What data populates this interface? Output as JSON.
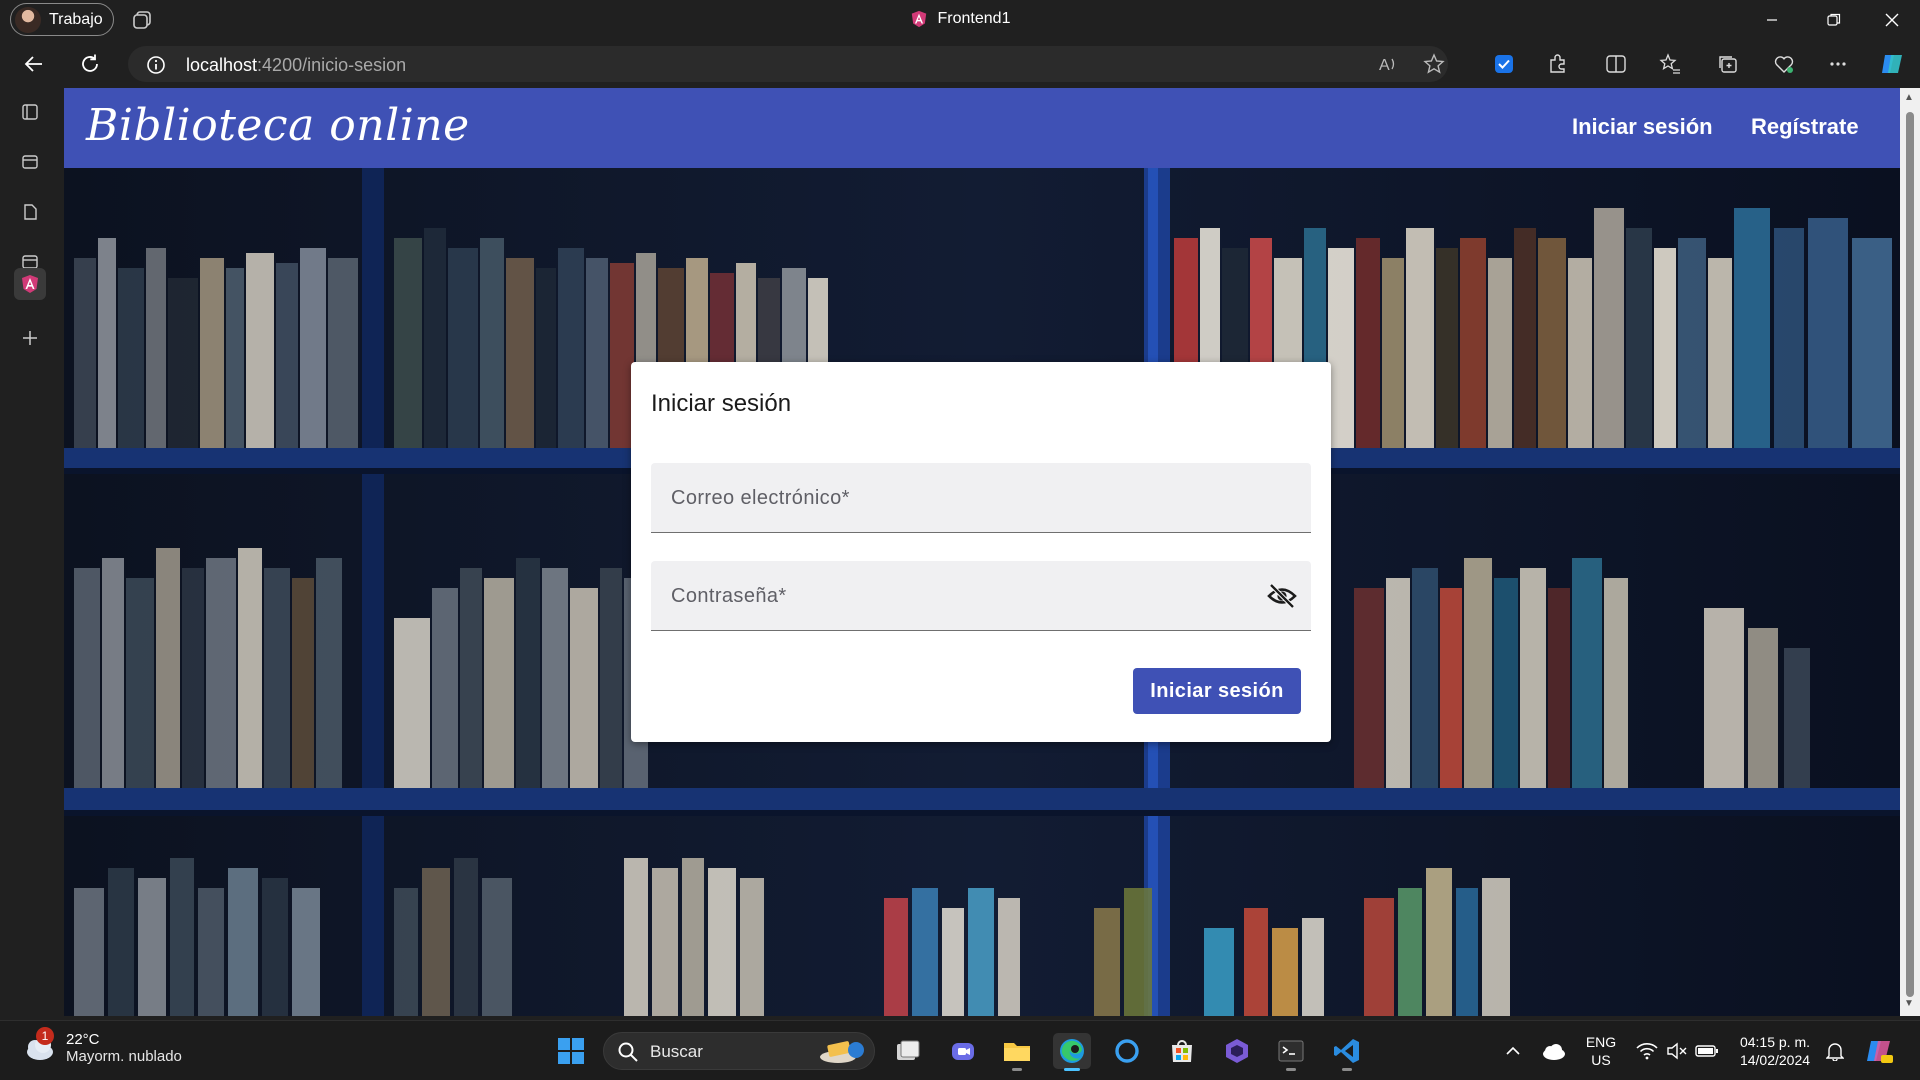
{
  "browser": {
    "profile_label": "Trabajo",
    "window_title": "Frontend1",
    "url_host": "localhost",
    "url_rest": ":4200/inicio-sesion"
  },
  "app": {
    "brand": "Biblioteca online",
    "nav": {
      "login": "Iniciar sesión",
      "register": "Regístrate"
    },
    "accent_color": "#3f51b5"
  },
  "login_card": {
    "title": "Iniciar sesión",
    "email_placeholder": "Correo electrónico*",
    "password_placeholder": "Contraseña*",
    "submit_label": "Iniciar sesión"
  },
  "taskbar": {
    "weather_temp": "22°C",
    "weather_desc": "Mayorm. nublado",
    "weather_badge": "1",
    "search_label": "Buscar",
    "lang_top": "ENG",
    "lang_bottom": "US",
    "time": "04:15 p. m.",
    "date": "14/02/2024"
  }
}
